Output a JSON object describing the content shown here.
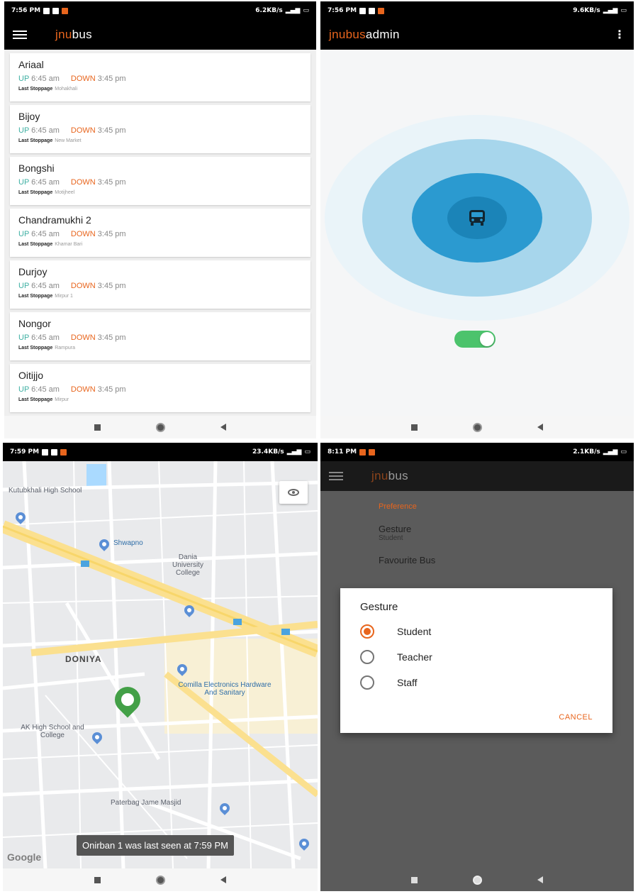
{
  "status_bars": [
    {
      "time": "7:56 PM",
      "net": "6.2KB/s"
    },
    {
      "time": "7:56 PM",
      "net": "9.6KB/s"
    },
    {
      "time": "7:59 PM",
      "net": "23.4KB/s"
    },
    {
      "time": "8:11 PM",
      "net": "2.1KB/s"
    }
  ],
  "panel1": {
    "brand_a": "jnu",
    "brand_b": "bus",
    "buses": [
      {
        "name": "Ariaal",
        "up_label": "UP",
        "up_time": "6:45 am",
        "down_label": "DOWN",
        "down_time": "3:45 pm",
        "stop_label": "Last Stoppage",
        "stop": "Mohakhali"
      },
      {
        "name": "Bijoy",
        "up_label": "UP",
        "up_time": "6:45 am",
        "down_label": "DOWN",
        "down_time": "3:45 pm",
        "stop_label": "Last Stoppage",
        "stop": "New Market"
      },
      {
        "name": "Bongshi",
        "up_label": "UP",
        "up_time": "6:45 am",
        "down_label": "DOWN",
        "down_time": "3:45 pm",
        "stop_label": "Last Stoppage",
        "stop": "Motijheel"
      },
      {
        "name": "Chandramukhi 2",
        "up_label": "UP",
        "up_time": "6:45 am",
        "down_label": "DOWN",
        "down_time": "3:45 pm",
        "stop_label": "Last Stoppage",
        "stop": "Khamar Bari"
      },
      {
        "name": "Durjoy",
        "up_label": "UP",
        "up_time": "6:45 am",
        "down_label": "DOWN",
        "down_time": "3:45 pm",
        "stop_label": "Last Stoppage",
        "stop": "Mirpur 1"
      },
      {
        "name": "Nongor",
        "up_label": "UP",
        "up_time": "6:45 am",
        "down_label": "DOWN",
        "down_time": "3:45 pm",
        "stop_label": "Last Stoppage",
        "stop": "Rampura"
      },
      {
        "name": "Oitijjo",
        "up_label": "UP",
        "up_time": "6:45 am",
        "down_label": "DOWN",
        "down_time": "3:45 pm",
        "stop_label": "Last Stoppage",
        "stop": "Mirpur"
      }
    ]
  },
  "panel2": {
    "brand_a": "jnubus",
    "brand_b": "admin",
    "menu": "⋮",
    "tracking_on": true
  },
  "panel3": {
    "labels": {
      "school": "Kutubkhali High School",
      "shwapno": "Shwapno",
      "college": "Dania University College",
      "doniya": "DONIYA",
      "comilla": "Comilla Electronics Hardware And Sanitary",
      "ak": "AK High School and College",
      "masjid": "Paterbag Jame Masjid"
    },
    "google": "Google",
    "toast": "Onirban 1 was last seen at 7:59 PM"
  },
  "panel4": {
    "brand_a": "jnu",
    "brand_b": "bus",
    "pref_category": "Preference",
    "gesture_title": "Gesture",
    "gesture_summary": "Student",
    "fav_title": "Favourite Bus",
    "dialog": {
      "title": "Gesture",
      "options": [
        "Student",
        "Teacher",
        "Staff"
      ],
      "selected": 0,
      "cancel": "CANCEL"
    }
  },
  "colors": {
    "accent": "#e8651d",
    "up": "#3fb0a3",
    "toggle": "#4cc36c",
    "radar_inner": "#1f8fc7"
  }
}
